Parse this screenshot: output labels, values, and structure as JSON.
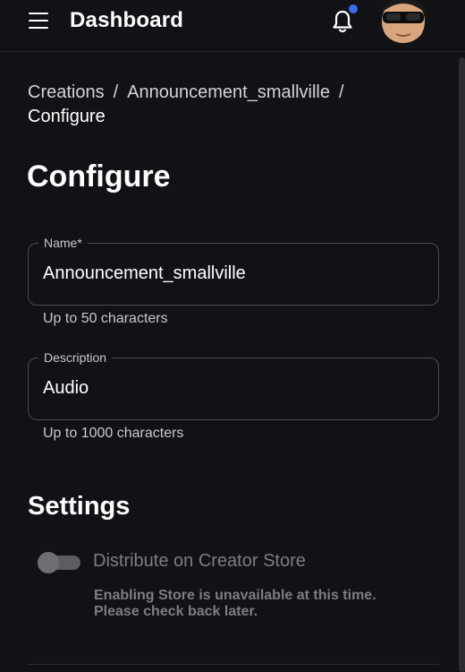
{
  "header": {
    "title": "Dashboard",
    "menu_icon": "hamburger-menu-icon",
    "bell_icon": "bell-icon",
    "notification_dot_color": "#3a6cf0"
  },
  "breadcrumb": {
    "items": [
      "Creations",
      "Announcement_smallville"
    ],
    "separator": "/",
    "current": "Configure"
  },
  "page": {
    "title": "Configure"
  },
  "form": {
    "name": {
      "label": "Name",
      "required_mark": "*",
      "value": "Announcement_smallville",
      "helper": "Up to 50 characters"
    },
    "description": {
      "label": "Description",
      "value": "Audio",
      "helper": "Up to 1000 characters"
    }
  },
  "settings": {
    "title": "Settings",
    "distribute_toggle": {
      "label": "Distribute on Creator Store",
      "state": "off",
      "disabled": true
    },
    "notice_line1": "Enabling Store is unavailable at this time.",
    "notice_line2": "Please check back later."
  },
  "colors": {
    "background": "#111216",
    "border": "#4a4c52",
    "muted_text": "#7c7e83"
  }
}
